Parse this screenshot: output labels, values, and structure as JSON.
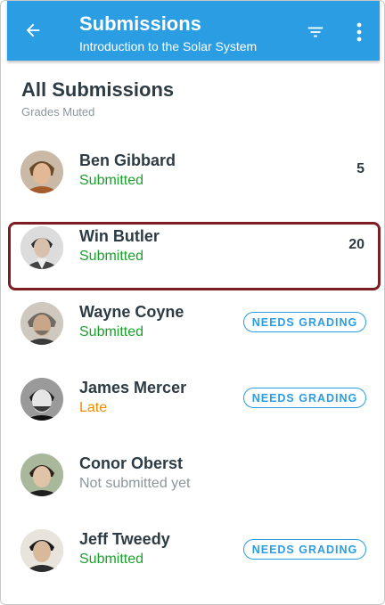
{
  "appbar": {
    "title": "Submissions",
    "subtitle": "Introduction to the Solar System",
    "color": "#2a9de3",
    "icons": [
      "back-arrow-icon",
      "filter-icon",
      "more-vert-icon"
    ]
  },
  "section": {
    "title": "All Submissions",
    "subtitle": "Grades Muted"
  },
  "submissions": [
    {
      "name": "Ben Gibbard",
      "status": "Submitted",
      "status_color": "#1e9e2f",
      "grade": "5",
      "badge": ""
    },
    {
      "name": "Win Butler",
      "status": "Submitted",
      "status_color": "#1e9e2f",
      "grade": "20",
      "badge": ""
    },
    {
      "name": "Wayne Coyne",
      "status": "Submitted",
      "status_color": "#1e9e2f",
      "grade": "",
      "badge": "NEEDS GRADING"
    },
    {
      "name": "James Mercer",
      "status": "Late",
      "status_color": "#ef8b00",
      "grade": "",
      "badge": "NEEDS GRADING"
    },
    {
      "name": "Conor Oberst",
      "status": "Not submitted yet",
      "status_color": "#8b969e",
      "grade": "",
      "badge": ""
    },
    {
      "name": "Jeff Tweedy",
      "status": "Submitted",
      "status_color": "#1e9e2f",
      "grade": "",
      "badge": "NEEDS GRADING"
    }
  ],
  "highlight_color": "#7d1d24"
}
